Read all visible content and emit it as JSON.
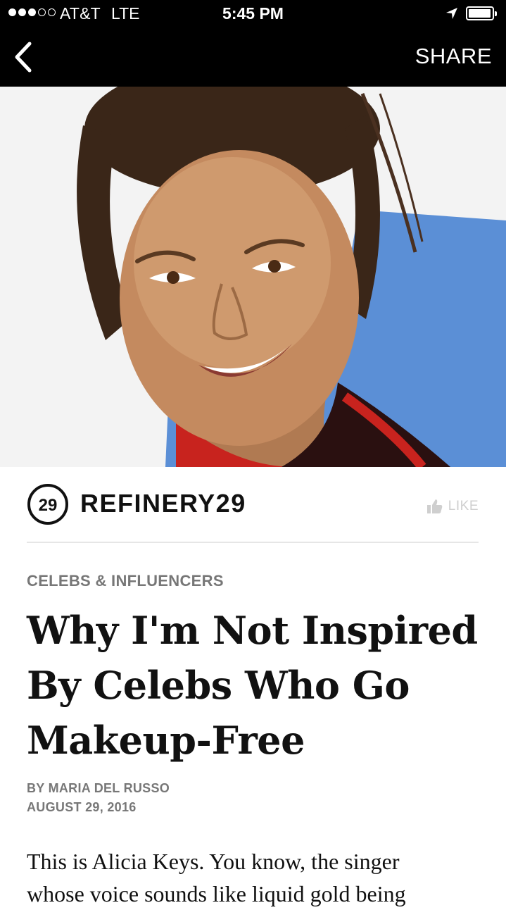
{
  "status_bar": {
    "carrier": "AT&T",
    "network": "LTE",
    "time": "5:45 PM"
  },
  "nav": {
    "share_label": "SHARE"
  },
  "publisher": {
    "name": "REFINERY29",
    "like_label": "LIKE"
  },
  "article": {
    "category": "CELEBS & INFLUENCERS",
    "title_lines": [
      "Why I'm Not Inspired",
      "By Celebs Who Go",
      "Makeup-Free"
    ],
    "author": "BY MARIA DEL RUSSO",
    "date": "AUGUST 29, 2016",
    "body_lines": [
      "This is Alicia Keys. You know, the singer",
      "whose voice sounds like liquid gold being"
    ]
  },
  "colors": {
    "topbar": "#000000",
    "meta_gray": "#777777",
    "like_gray": "#cfcfcf"
  }
}
